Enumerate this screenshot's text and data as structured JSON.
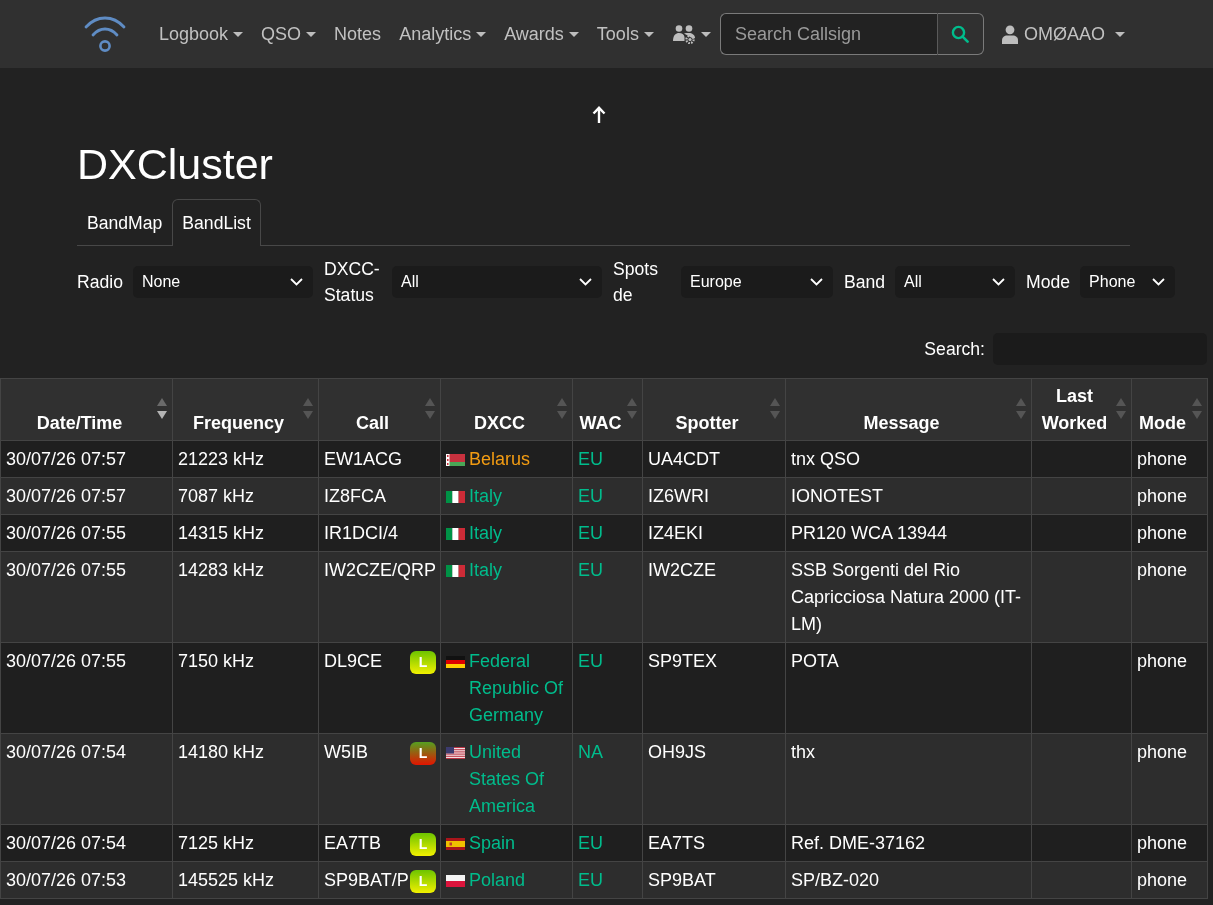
{
  "navbar": {
    "menu": [
      {
        "kind": "text",
        "label": "Logbook",
        "dropdown": true
      },
      {
        "kind": "text",
        "label": "QSO",
        "dropdown": true
      },
      {
        "kind": "text",
        "label": "Notes",
        "dropdown": false
      },
      {
        "kind": "text",
        "label": "Analytics",
        "dropdown": true
      },
      {
        "kind": "text",
        "label": "Awards",
        "dropdown": true
      },
      {
        "kind": "text",
        "label": "Tools",
        "dropdown": true
      },
      {
        "kind": "icon",
        "dropdown": true
      }
    ],
    "search": {
      "placeholder": "Search Callsign"
    },
    "user": {
      "label": "OMØAAO",
      "dropdown": true
    }
  },
  "page": {
    "title": "DXCluster"
  },
  "tabs": [
    {
      "label": "BandMap",
      "selected": false
    },
    {
      "label": "BandList",
      "selected": true
    }
  ],
  "filters": [
    {
      "label": "Radio",
      "value": "None"
    },
    {
      "label": "DXCC-Status",
      "value": "All"
    },
    {
      "label": "Spots de",
      "value": "Europe"
    },
    {
      "label": "Band",
      "value": "All"
    },
    {
      "label": "Mode",
      "value": "Phone"
    }
  ],
  "table_search": {
    "label": "Search:"
  },
  "table": {
    "columns": [
      {
        "label": "Date/Time",
        "sorted": true
      },
      {
        "label": "Frequency",
        "sorted": false
      },
      {
        "label": "Call",
        "sorted": false
      },
      {
        "label": "DXCC",
        "sorted": false
      },
      {
        "label": "WAC",
        "sorted": false
      },
      {
        "label": "Spotter",
        "sorted": false
      },
      {
        "label": "Message",
        "sorted": false
      },
      {
        "label": "Last Worked",
        "sorted": false
      },
      {
        "label": "Mode",
        "sorted": false
      }
    ],
    "rows": [
      {
        "datetime": "30/07/26 07:57",
        "frequency": "21223 kHz",
        "call": "EW1ACG",
        "dxcc": {
          "kind": "belarus",
          "name": "Belarus",
          "color": "#f39c12"
        },
        "continent": "EU",
        "spotter": "UA4CDT",
        "message": "tnx QSO",
        "mode": "phone"
      },
      {
        "datetime": "30/07/26 07:57",
        "frequency": "7087 kHz",
        "call": "IZ8FCA",
        "dxcc": {
          "kind": "italy",
          "name": "Italy",
          "color": "#00bc8c"
        },
        "continent": "EU",
        "spotter": "IZ6WRI",
        "message": "IONOTEST",
        "mode": "phone"
      },
      {
        "datetime": "30/07/26 07:55",
        "frequency": "14315 kHz",
        "call": "IR1DCI/4",
        "dxcc": {
          "kind": "italy",
          "name": "Italy",
          "color": "#00bc8c"
        },
        "continent": "EU",
        "spotter": "IZ4EKI",
        "message": "PR120 WCA 13944",
        "mode": "phone"
      },
      {
        "datetime": "30/07/26 07:55",
        "frequency": "14283 kHz",
        "call": "IW2CZE/QRP",
        "dxcc": {
          "kind": "italy",
          "name": "Italy",
          "color": "#00bc8c"
        },
        "continent": "EU",
        "spotter": "IW2CZE",
        "message": "SSB Sorgenti del Rio Capricciosa Natura 2000 (IT-LM)",
        "mode": "phone"
      },
      {
        "datetime": "30/07/26 07:55",
        "frequency": "7150 kHz",
        "call": "DL9CE",
        "lotw": {
          "label": "L",
          "kind": "recent"
        },
        "dxcc": {
          "kind": "germany",
          "name": "Federal Republic Of Germany",
          "color": "#00bc8c"
        },
        "continent": "EU",
        "spotter": "SP9TEX",
        "message": "POTA",
        "mode": "phone"
      },
      {
        "datetime": "30/07/26 07:54",
        "frequency": "14180 kHz",
        "call": "W5IB",
        "lotw": {
          "label": "L",
          "kind": "stale"
        },
        "dxcc": {
          "kind": "usa",
          "name": "United States Of America",
          "color": "#00bc8c"
        },
        "continent": "NA",
        "spotter": "OH9JS",
        "message": "thx",
        "mode": "phone"
      },
      {
        "datetime": "30/07/26 07:54",
        "frequency": "7125 kHz",
        "call": "EA7TB",
        "lotw": {
          "label": "L",
          "kind": "recent"
        },
        "dxcc": {
          "kind": "spain",
          "name": "Spain",
          "color": "#00bc8c"
        },
        "continent": "EU",
        "spotter": "EA7TS",
        "message": "Ref. DME-37162",
        "mode": "phone"
      },
      {
        "datetime": "30/07/26 07:53",
        "frequency": "145525 kHz",
        "call": "SP9BAT/P",
        "lotw": {
          "label": "L",
          "kind": "recent"
        },
        "dxcc": {
          "kind": "poland",
          "name": "Poland",
          "color": "#00bc8c"
        },
        "continent": "EU",
        "spotter": "SP9BAT",
        "message": "SP/BZ-020",
        "mode": "phone"
      }
    ]
  }
}
